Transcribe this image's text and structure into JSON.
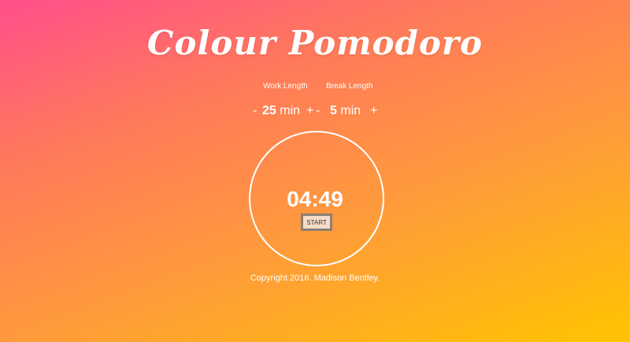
{
  "app": {
    "title": "Colour Pomodoro"
  },
  "settings": {
    "work_label": "Work Length",
    "break_label": "Break Length",
    "work_value": "25",
    "break_value": "5",
    "unit": "min",
    "decrement": "-",
    "increment": "+"
  },
  "timer": {
    "display": "04:49",
    "start_label": "START"
  },
  "footer": {
    "copyright": "Copyright 2016. Madison Bentley."
  },
  "colors": {
    "gradient_start": "#ff4f8b",
    "gradient_mid": "#ff9a3c",
    "gradient_end": "#ffc400",
    "text": "#ffffff",
    "button_bg": "#f6dcc8"
  }
}
